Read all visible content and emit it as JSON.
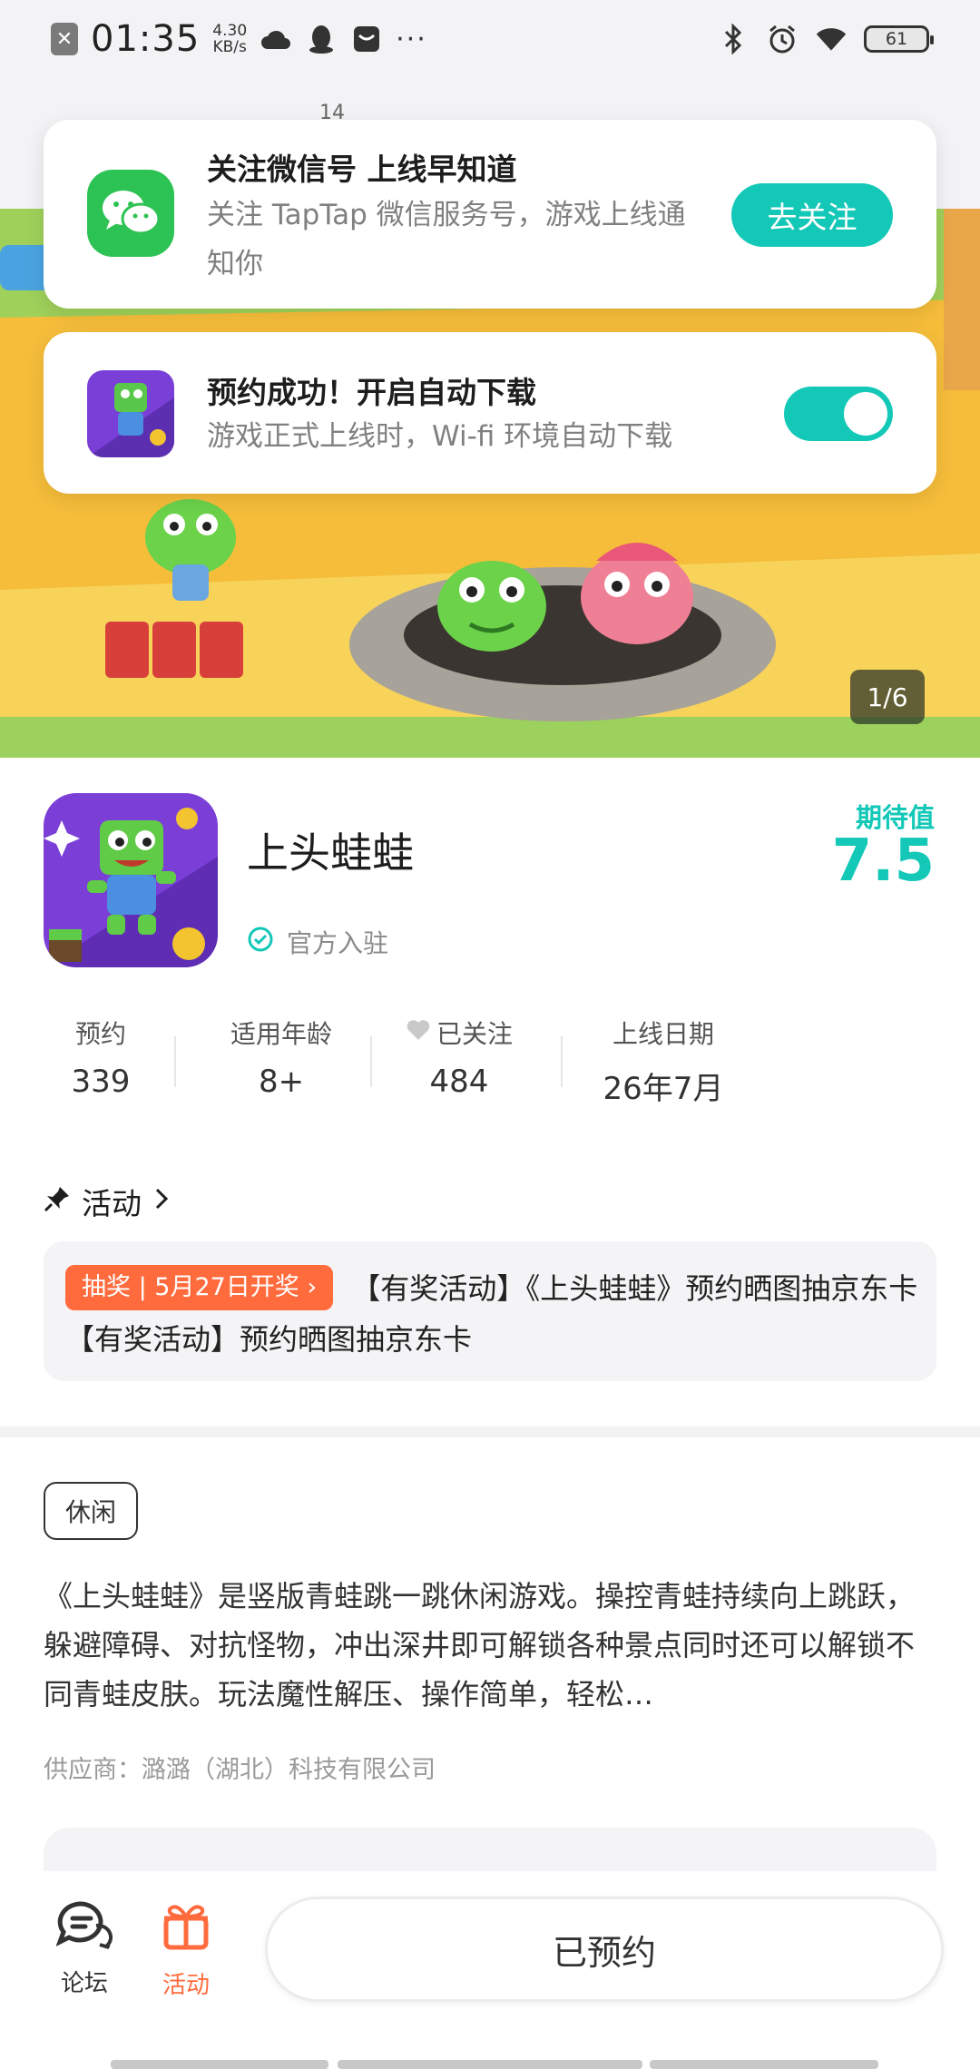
{
  "status_bar": {
    "time": "01:35",
    "net_speed_value": "4.30",
    "net_speed_unit": "KB/s",
    "battery": "61"
  },
  "top_strip": {
    "number": "14"
  },
  "wechat_card": {
    "title": "关注微信号 上线早知道",
    "subtitle": "关注 TapTap 微信服务号，游戏上线通知你",
    "button": "去关注"
  },
  "reserve_card": {
    "title": "预约成功！开启自动下载",
    "subtitle": "游戏正式上线时，Wi-fi 环境自动下载",
    "auto_download_enabled": true
  },
  "hero": {
    "counter": "1/6"
  },
  "game": {
    "name": "上头蛙蛙",
    "official": "官方入驻",
    "expect_label": "期待值",
    "expect_value": "7.5"
  },
  "stats": [
    {
      "label": "预约",
      "value": "339"
    },
    {
      "label": "适用年龄",
      "value": "8+"
    },
    {
      "label": "已关注",
      "value": "484"
    },
    {
      "label": "上线日期",
      "value": "26年7月"
    }
  ],
  "activity": {
    "heading": "活动",
    "badge": "抽奖 | 5月27日开奖",
    "text": "【有奖活动】《上头蛙蛙》预约晒图抽京东卡 【有奖活动】预约晒图抽京东卡"
  },
  "tag": "休闲",
  "description": "《上头蛙蛙》是竖版青蛙跳一跳休闲游戏。操控青蛙持续向上跳跃，躲避障碍、对抗怪物，冲出深井即可解锁各种景点同时还可以解锁不同青蛙皮肤。玩法魔性解压、操作简单，轻松…",
  "supplier": "供应商：潞潞（湖北）科技有限公司",
  "bottom_bar": {
    "forum": "论坛",
    "activity": "活动",
    "reserved_button": "已预约"
  },
  "colors": {
    "accent": "#14c8b8",
    "orange": "#ff6b3d",
    "wechat_green": "#2dc254"
  }
}
